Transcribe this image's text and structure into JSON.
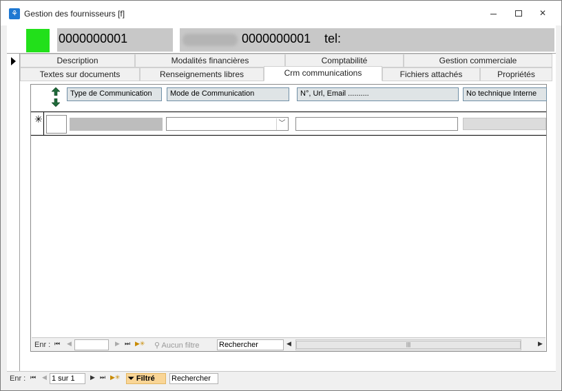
{
  "window": {
    "title": "Gestion des fournisseurs [f]",
    "app_icon_glyph": "⚘"
  },
  "header": {
    "status_color": "#22e01a",
    "code": "0000000001",
    "name_code": "0000000001",
    "tel_label": "tel:"
  },
  "tabs_row1": [
    {
      "label": "Description"
    },
    {
      "label": "Modalités financières"
    },
    {
      "label": "Comptabilité"
    },
    {
      "label": "Gestion commerciale"
    }
  ],
  "tabs_row2": [
    {
      "label": "Textes sur documents"
    },
    {
      "label": "Renseignements libres"
    },
    {
      "label": "Crm communications",
      "active": true
    },
    {
      "label": "Fichiers attachés"
    },
    {
      "label": "Propriétés"
    }
  ],
  "subform": {
    "columns": [
      {
        "label": "Type de Communication"
      },
      {
        "label": "Mode de Communication"
      },
      {
        "label": "N°, Url, Email .........."
      },
      {
        "label": "No technique Interne"
      }
    ],
    "new_row_marker": "✳",
    "nav": {
      "label": "Enr :",
      "record_value": "",
      "filter_label": "Aucun filtre",
      "search_label": "Rechercher"
    }
  },
  "main_nav": {
    "label": "Enr :",
    "record_value": "1 sur 1",
    "filter_label": "Filtré",
    "search_label": "Rechercher"
  }
}
